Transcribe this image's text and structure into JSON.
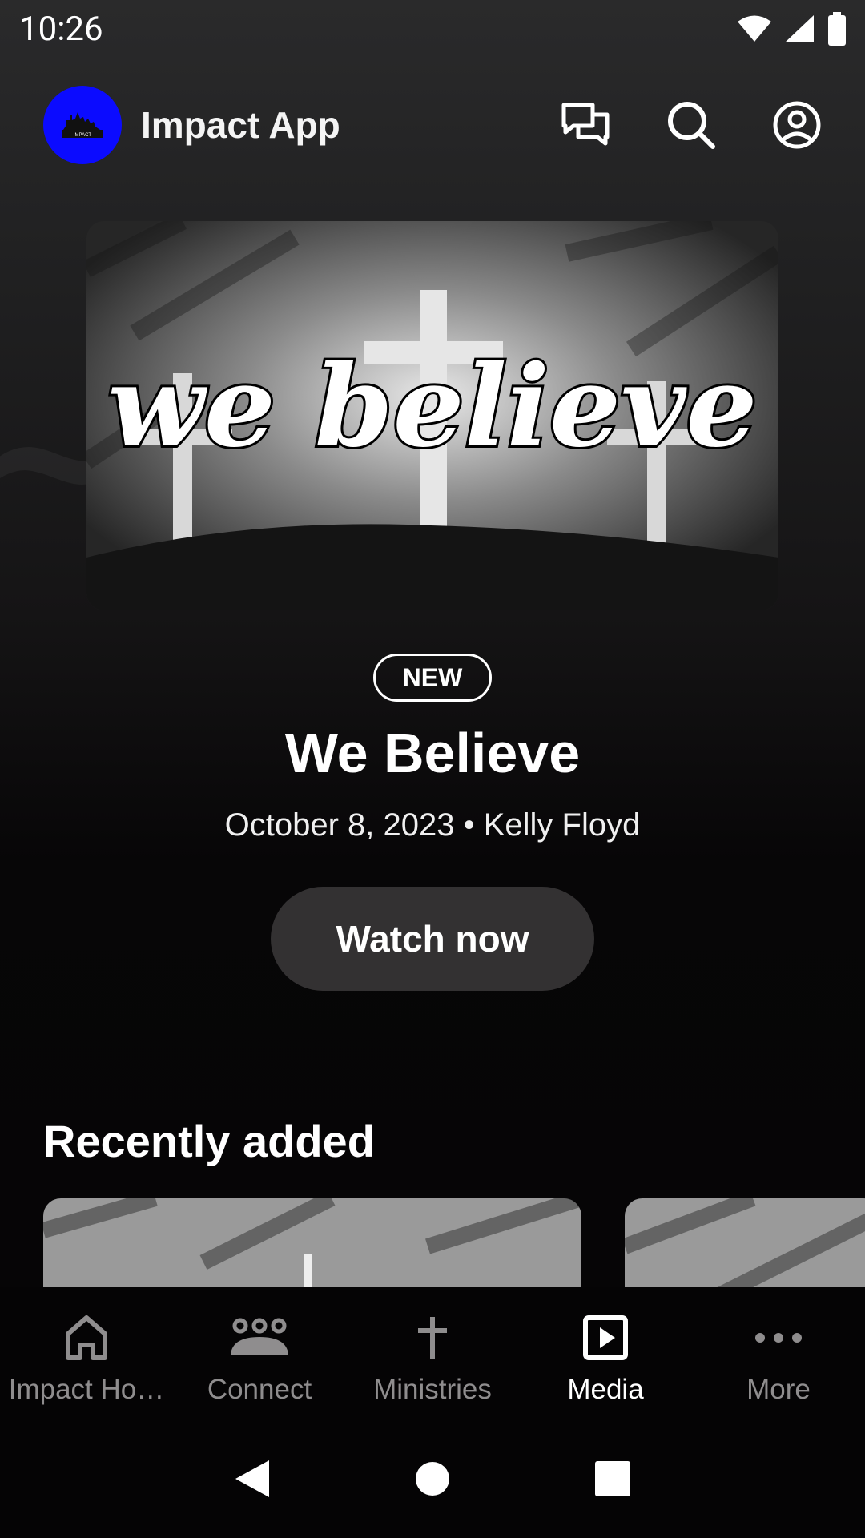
{
  "status_bar": {
    "time": "10:26"
  },
  "app_bar": {
    "title": "Impact App",
    "logo_text": "IMPACT",
    "icons": [
      "chat-bubbles-icon",
      "search-icon",
      "account-circle-icon"
    ]
  },
  "hero": {
    "image_text": "we believe",
    "badge": "NEW",
    "title": "We Believe",
    "meta": "October 8, 2023 • Kelly Floyd",
    "watch_label": "Watch now"
  },
  "recently_added": {
    "title": "Recently added"
  },
  "bottom_nav": {
    "items": [
      {
        "label": "Impact Ho…",
        "icon": "home-icon",
        "active": false
      },
      {
        "label": "Connect",
        "icon": "people-group-icon",
        "active": false
      },
      {
        "label": "Ministries",
        "icon": "cross-icon",
        "active": false
      },
      {
        "label": "Media",
        "icon": "play-square-icon",
        "active": true
      },
      {
        "label": "More",
        "icon": "more-dots-icon",
        "active": false
      }
    ]
  },
  "colors": {
    "logo_blue": "#0b0bff",
    "button_bg": "#333132",
    "nav_inactive": "#8f8d8e",
    "nav_active": "#ffffff"
  }
}
